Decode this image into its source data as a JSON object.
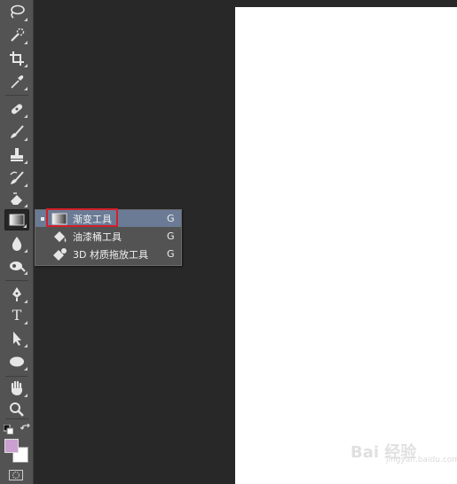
{
  "toolbar": {
    "type_tool_glyph": "T",
    "tools": [
      {
        "name": "lasso-icon"
      },
      {
        "name": "quick-selection-icon"
      },
      {
        "name": "crop-icon"
      },
      {
        "name": "eyedropper-icon"
      },
      {
        "name": "healing-brush-icon"
      },
      {
        "name": "brush-icon"
      },
      {
        "name": "clone-stamp-icon"
      },
      {
        "name": "history-brush-icon"
      },
      {
        "name": "eraser-icon"
      },
      {
        "name": "gradient-icon",
        "active": true
      },
      {
        "name": "blur-icon"
      },
      {
        "name": "dodge-icon"
      },
      {
        "name": "pen-icon"
      },
      {
        "name": "type-icon"
      },
      {
        "name": "path-selection-icon"
      },
      {
        "name": "ellipse-icon"
      },
      {
        "name": "hand-icon"
      },
      {
        "name": "zoom-icon"
      }
    ],
    "foreground_color": "#c9a0d0",
    "background_color": "#ffffff"
  },
  "flyout": {
    "items": [
      {
        "label": "渐变工具",
        "shortcut": "G",
        "icon": "gradient-icon",
        "selected": true
      },
      {
        "label": "油漆桶工具",
        "shortcut": "G",
        "icon": "paint-bucket-icon",
        "selected": false
      },
      {
        "label": "3D 材质拖放工具",
        "shortcut": "G",
        "icon": "3d-material-drop-icon",
        "selected": false
      }
    ]
  },
  "watermark": {
    "text": "Bai 经验",
    "sub": "jingyan.baidu.com"
  },
  "colors": {
    "panel": "#535353",
    "workspace": "#282828",
    "highlight": "#6b7b95",
    "annotation": "#d21f2a"
  }
}
